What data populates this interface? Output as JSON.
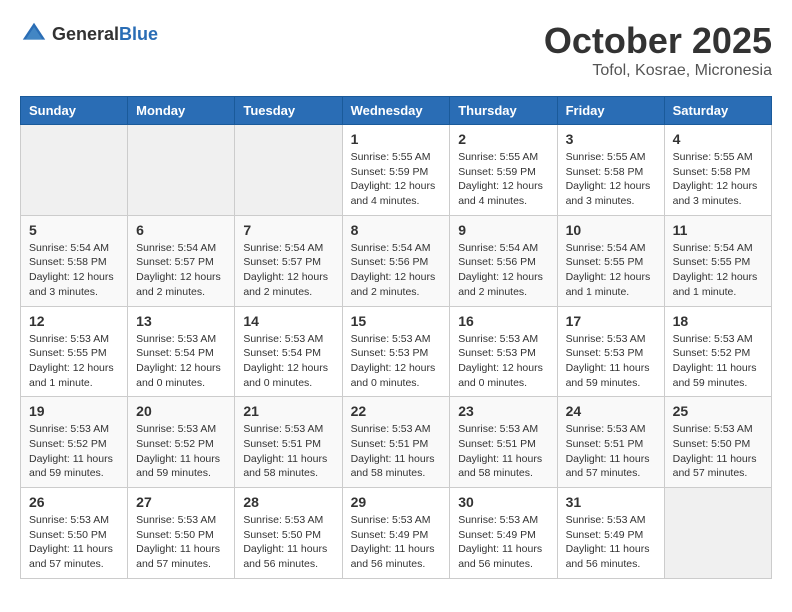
{
  "header": {
    "logo_general": "General",
    "logo_blue": "Blue",
    "month": "October 2025",
    "location": "Tofol, Kosrae, Micronesia"
  },
  "weekdays": [
    "Sunday",
    "Monday",
    "Tuesday",
    "Wednesday",
    "Thursday",
    "Friday",
    "Saturday"
  ],
  "weeks": [
    [
      {
        "day": "",
        "info": ""
      },
      {
        "day": "",
        "info": ""
      },
      {
        "day": "",
        "info": ""
      },
      {
        "day": "1",
        "info": "Sunrise: 5:55 AM\nSunset: 5:59 PM\nDaylight: 12 hours\nand 4 minutes."
      },
      {
        "day": "2",
        "info": "Sunrise: 5:55 AM\nSunset: 5:59 PM\nDaylight: 12 hours\nand 4 minutes."
      },
      {
        "day": "3",
        "info": "Sunrise: 5:55 AM\nSunset: 5:58 PM\nDaylight: 12 hours\nand 3 minutes."
      },
      {
        "day": "4",
        "info": "Sunrise: 5:55 AM\nSunset: 5:58 PM\nDaylight: 12 hours\nand 3 minutes."
      }
    ],
    [
      {
        "day": "5",
        "info": "Sunrise: 5:54 AM\nSunset: 5:58 PM\nDaylight: 12 hours\nand 3 minutes."
      },
      {
        "day": "6",
        "info": "Sunrise: 5:54 AM\nSunset: 5:57 PM\nDaylight: 12 hours\nand 2 minutes."
      },
      {
        "day": "7",
        "info": "Sunrise: 5:54 AM\nSunset: 5:57 PM\nDaylight: 12 hours\nand 2 minutes."
      },
      {
        "day": "8",
        "info": "Sunrise: 5:54 AM\nSunset: 5:56 PM\nDaylight: 12 hours\nand 2 minutes."
      },
      {
        "day": "9",
        "info": "Sunrise: 5:54 AM\nSunset: 5:56 PM\nDaylight: 12 hours\nand 2 minutes."
      },
      {
        "day": "10",
        "info": "Sunrise: 5:54 AM\nSunset: 5:55 PM\nDaylight: 12 hours\nand 1 minute."
      },
      {
        "day": "11",
        "info": "Sunrise: 5:54 AM\nSunset: 5:55 PM\nDaylight: 12 hours\nand 1 minute."
      }
    ],
    [
      {
        "day": "12",
        "info": "Sunrise: 5:53 AM\nSunset: 5:55 PM\nDaylight: 12 hours\nand 1 minute."
      },
      {
        "day": "13",
        "info": "Sunrise: 5:53 AM\nSunset: 5:54 PM\nDaylight: 12 hours\nand 0 minutes."
      },
      {
        "day": "14",
        "info": "Sunrise: 5:53 AM\nSunset: 5:54 PM\nDaylight: 12 hours\nand 0 minutes."
      },
      {
        "day": "15",
        "info": "Sunrise: 5:53 AM\nSunset: 5:53 PM\nDaylight: 12 hours\nand 0 minutes."
      },
      {
        "day": "16",
        "info": "Sunrise: 5:53 AM\nSunset: 5:53 PM\nDaylight: 12 hours\nand 0 minutes."
      },
      {
        "day": "17",
        "info": "Sunrise: 5:53 AM\nSunset: 5:53 PM\nDaylight: 11 hours\nand 59 minutes."
      },
      {
        "day": "18",
        "info": "Sunrise: 5:53 AM\nSunset: 5:52 PM\nDaylight: 11 hours\nand 59 minutes."
      }
    ],
    [
      {
        "day": "19",
        "info": "Sunrise: 5:53 AM\nSunset: 5:52 PM\nDaylight: 11 hours\nand 59 minutes."
      },
      {
        "day": "20",
        "info": "Sunrise: 5:53 AM\nSunset: 5:52 PM\nDaylight: 11 hours\nand 59 minutes."
      },
      {
        "day": "21",
        "info": "Sunrise: 5:53 AM\nSunset: 5:51 PM\nDaylight: 11 hours\nand 58 minutes."
      },
      {
        "day": "22",
        "info": "Sunrise: 5:53 AM\nSunset: 5:51 PM\nDaylight: 11 hours\nand 58 minutes."
      },
      {
        "day": "23",
        "info": "Sunrise: 5:53 AM\nSunset: 5:51 PM\nDaylight: 11 hours\nand 58 minutes."
      },
      {
        "day": "24",
        "info": "Sunrise: 5:53 AM\nSunset: 5:51 PM\nDaylight: 11 hours\nand 57 minutes."
      },
      {
        "day": "25",
        "info": "Sunrise: 5:53 AM\nSunset: 5:50 PM\nDaylight: 11 hours\nand 57 minutes."
      }
    ],
    [
      {
        "day": "26",
        "info": "Sunrise: 5:53 AM\nSunset: 5:50 PM\nDaylight: 11 hours\nand 57 minutes."
      },
      {
        "day": "27",
        "info": "Sunrise: 5:53 AM\nSunset: 5:50 PM\nDaylight: 11 hours\nand 57 minutes."
      },
      {
        "day": "28",
        "info": "Sunrise: 5:53 AM\nSunset: 5:50 PM\nDaylight: 11 hours\nand 56 minutes."
      },
      {
        "day": "29",
        "info": "Sunrise: 5:53 AM\nSunset: 5:49 PM\nDaylight: 11 hours\nand 56 minutes."
      },
      {
        "day": "30",
        "info": "Sunrise: 5:53 AM\nSunset: 5:49 PM\nDaylight: 11 hours\nand 56 minutes."
      },
      {
        "day": "31",
        "info": "Sunrise: 5:53 AM\nSunset: 5:49 PM\nDaylight: 11 hours\nand 56 minutes."
      },
      {
        "day": "",
        "info": ""
      }
    ]
  ]
}
